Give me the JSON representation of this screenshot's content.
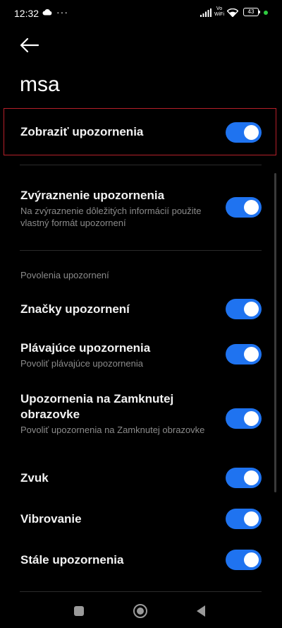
{
  "status_bar": {
    "time": "12:32",
    "dots": "···",
    "volte_line1": "Vo",
    "volte_line2": "WiFi",
    "battery": "43"
  },
  "header": {
    "title": "msa"
  },
  "settings": {
    "show_notifications": {
      "label": "Zobraziť upozornenia",
      "enabled": true
    },
    "highlight": {
      "label": "Zvýraznenie upozornenia",
      "description": "Na zvýraznenie dôležitých informácií použite vlastný formát upozornení",
      "enabled": true
    },
    "section_title": "Povolenia upozornení",
    "badges": {
      "label": "Značky upozornení",
      "enabled": true
    },
    "floating": {
      "label": "Plávajúce upozornenia",
      "description": "Povoliť plávajúce upozornenia",
      "enabled": true
    },
    "lock_screen": {
      "label": "Upozornenia na Zamknutej obrazovke",
      "description": "Povoliť upozornenia na Zamknutej obrazovke",
      "enabled": true
    },
    "sound": {
      "label": "Zvuk",
      "enabled": true
    },
    "vibration": {
      "label": "Vibrovanie",
      "enabled": true
    },
    "persistent": {
      "label": "Stále upozornenia",
      "enabled": true
    }
  },
  "colors": {
    "toggle_on": "#1f73f0",
    "highlight_border": "#b5202a",
    "background": "#000000"
  }
}
